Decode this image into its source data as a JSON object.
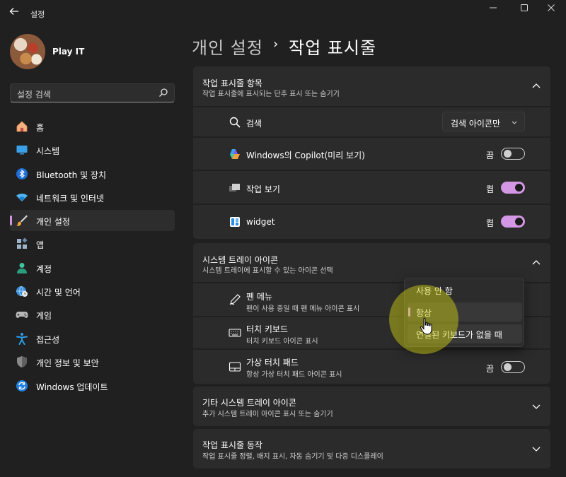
{
  "window": {
    "title": "설정",
    "controls": {
      "minimize": "—",
      "maximize": "☐",
      "close": "✕"
    }
  },
  "profile": {
    "name": "Play IT"
  },
  "search": {
    "placeholder": "설정 검색"
  },
  "nav": {
    "items": [
      {
        "label": "홈",
        "icon": "home-icon"
      },
      {
        "label": "시스템",
        "icon": "system-icon"
      },
      {
        "label": "Bluetooth 및 장치",
        "icon": "bluetooth-icon"
      },
      {
        "label": "네트워크 및 인터넷",
        "icon": "network-icon"
      },
      {
        "label": "개인 설정",
        "icon": "brush-icon",
        "active": true
      },
      {
        "label": "앱",
        "icon": "apps-icon"
      },
      {
        "label": "계정",
        "icon": "account-icon"
      },
      {
        "label": "시간 및 언어",
        "icon": "globe-clock-icon"
      },
      {
        "label": "게임",
        "icon": "gamepad-icon"
      },
      {
        "label": "접근성",
        "icon": "accessibility-icon"
      },
      {
        "label": "개인 정보 및 보안",
        "icon": "shield-icon"
      },
      {
        "label": "Windows 업데이트",
        "icon": "update-icon"
      }
    ]
  },
  "breadcrumb": {
    "parent": "개인 설정",
    "separator": "›",
    "current": "작업 표시줄"
  },
  "taskbar_items": {
    "title": "작업 표시줄 항목",
    "desc": "작업 표시줄에 표시되는 단추 표시 또는 숨기기",
    "rows": [
      {
        "label": "검색",
        "icon": "search-icon",
        "control": "dropdown",
        "value": "검색 아이콘만"
      },
      {
        "label": "Windows의 Copilot(미리 보기)",
        "icon": "copilot-icon",
        "control": "toggle",
        "state": "끔",
        "on": false
      },
      {
        "label": "작업 보기",
        "icon": "task-view-icon",
        "control": "toggle",
        "state": "켬",
        "on": true
      },
      {
        "label": "widget",
        "icon": "widgets-icon",
        "control": "toggle",
        "state": "켬",
        "on": true
      }
    ]
  },
  "tray_icons": {
    "title": "시스템 트레이 아이콘",
    "desc": "시스템 트레이에 표시할 수 있는 아이콘 선택",
    "rows": [
      {
        "label": "펜 메뉴",
        "desc": "펜이 사용 중일 때 펜 메뉴 아이콘 표시",
        "icon": "pen-icon"
      },
      {
        "label": "터치 키보드",
        "desc": "터치 키보드 아이콘 표시",
        "icon": "keyboard-icon"
      },
      {
        "label": "가상 터치 패드",
        "desc": "항상 가상 터치 패드 아이콘 표시",
        "icon": "touchpad-icon",
        "state": "끔",
        "on": false
      }
    ]
  },
  "popup_menu": {
    "options": [
      {
        "label": "사용 안 함"
      },
      {
        "label": "항상",
        "selected": true
      },
      {
        "label": "연결된 키보드가 없을 때"
      }
    ]
  },
  "other_tray": {
    "title": "기타 시스템 트레이 아이콘",
    "desc": "추가 시스템 트레이 아이콘 표시 또는 숨기기"
  },
  "taskbar_behavior": {
    "title": "작업 표시줄 동작",
    "desc": "작업 표시줄 정렬, 배지 표시, 자동 숨기기 및 다중 디스플레이"
  },
  "colors": {
    "accent": "#d497e6",
    "background": "#202020",
    "card": "#2b2b2b"
  }
}
